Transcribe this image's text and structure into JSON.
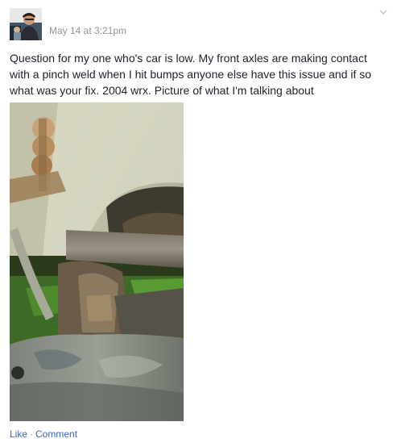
{
  "post": {
    "timestamp": "May 14 at 3:21pm",
    "text": "Question for my one who's car is low. My front axles are making contact with a pinch weld when I hit bumps anyone else have this issue and if so what was your fix. 2004 wrx. Picture of what I'm talking about",
    "photo_icon": "car-undercarriage-photo",
    "menu_icon": "chevron-down-icon"
  },
  "actions": {
    "like_label": "Like",
    "separator": "·",
    "comment_label": "Comment"
  },
  "colors": {
    "link": "#4267b2",
    "meta": "#90949c",
    "text": "#1d2129"
  }
}
